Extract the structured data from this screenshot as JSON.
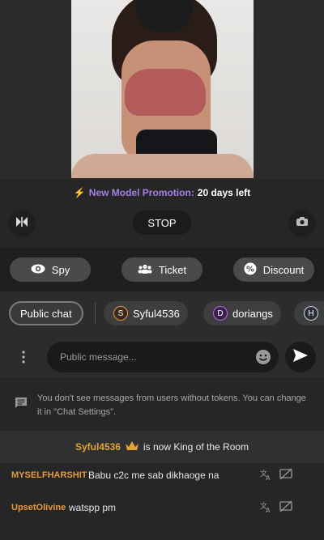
{
  "promo": {
    "label": "New Model Promotion:",
    "value": "20 days left"
  },
  "controls": {
    "stop_label": "STOP"
  },
  "actions": {
    "spy": "Spy",
    "ticket": "Ticket",
    "discount": "Discount"
  },
  "tabs": [
    {
      "label": "Public chat"
    },
    {
      "label": "Syful4536",
      "initial": "S"
    },
    {
      "label": "doriangs",
      "initial": "D"
    },
    {
      "label": "",
      "initial": "H"
    }
  ],
  "composer": {
    "placeholder": "Public message..."
  },
  "notice": {
    "text": "You don't see messages from users without tokens. You can change it in \"Chat Settings\"."
  },
  "king": {
    "user": "Syful4536",
    "text": "is now King of the Room"
  },
  "messages": [
    {
      "user": "MYSELFHARSHIT",
      "text": "Babu c2c me sab dikhaoge na"
    },
    {
      "user": "UpsetOlivine",
      "text": "watspp pm"
    }
  ],
  "colors": {
    "accent_purple": "#a67ee8",
    "username_orange": "#e79b3b",
    "king_gold": "#e0a33a"
  }
}
